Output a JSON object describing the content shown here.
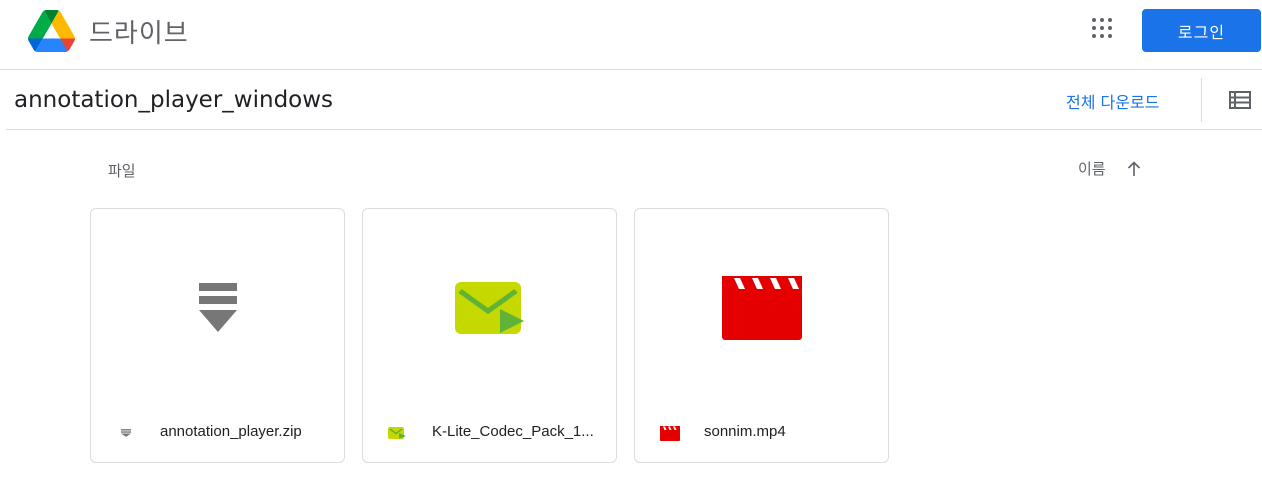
{
  "header": {
    "app_name": "드라이브",
    "login_label": "로그인"
  },
  "folder": {
    "title": "annotation_player_windows",
    "download_all_label": "전체 다운로드"
  },
  "files_section": {
    "label": "파일",
    "sort_label": "이름",
    "sort_direction": "ascending"
  },
  "files": [
    {
      "name": "annotation_player.zip",
      "type_icon": "zip-archive-icon",
      "color": "#777777"
    },
    {
      "name": "K-Lite_Codec_Pack_1...",
      "type_icon": "installer-icon",
      "color": "#c5d900"
    },
    {
      "name": "sonnim.mp4",
      "type_icon": "video-icon",
      "color": "#e50000"
    }
  ],
  "colors": {
    "accent": "#1a73e8",
    "divider": "#dadce0",
    "text_secondary": "#5f6368"
  }
}
